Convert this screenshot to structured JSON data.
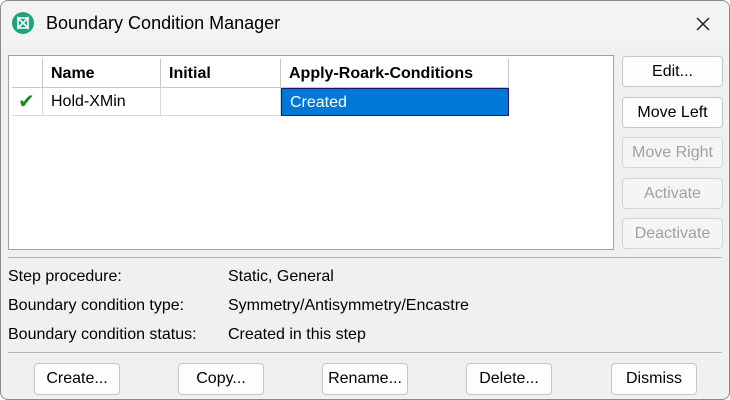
{
  "window": {
    "title": "Boundary Condition Manager"
  },
  "table": {
    "headers": [
      "Name",
      "Initial",
      "Apply-Roark-Conditions"
    ],
    "rows": [
      {
        "checked": true,
        "name": "Hold-XMin",
        "initial": "",
        "step": "Created"
      }
    ]
  },
  "side_buttons": {
    "edit": "Edit...",
    "move_left": "Move Left",
    "move_right": "Move Right",
    "activate": "Activate",
    "deactivate": "Deactivate"
  },
  "info": {
    "step_procedure_label": "Step procedure:",
    "step_procedure_value": "Static, General",
    "bc_type_label": "Boundary condition type:",
    "bc_type_value": "Symmetry/Antisymmetry/Encastre",
    "bc_status_label": "Boundary condition status:",
    "bc_status_value": "Created in this step"
  },
  "bottom_buttons": {
    "create": "Create...",
    "copy": "Copy...",
    "rename": "Rename...",
    "delete": "Delete...",
    "dismiss": "Dismiss"
  },
  "colors": {
    "selection": "#0078d7",
    "check": "#1f8a1f",
    "app_icon": "#1fa37a"
  },
  "icons": {
    "app": "abaqus-app-icon",
    "close": "close-icon",
    "check": "check-icon"
  }
}
